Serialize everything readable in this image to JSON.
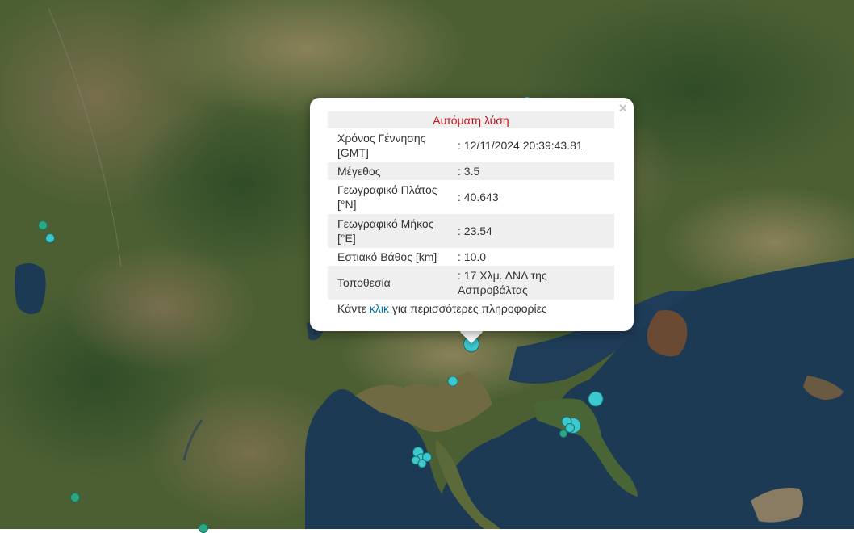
{
  "map": {
    "markers": [
      {
        "label": "earthquake-epicenter",
        "color": "#3cc8cf",
        "size": "medium"
      },
      {
        "label": "earthquake-epicenter",
        "color": "#3cc8cf",
        "size": "small"
      },
      {
        "label": "earthquake-epicenter",
        "color": "#3cc8cf",
        "size": "medium"
      },
      {
        "label": "earthquake-epicenter",
        "color": "#3cc8cf",
        "size": "medium"
      },
      {
        "label": "earthquake-epicenter",
        "color": "#3cc8cf",
        "size": "small"
      },
      {
        "label": "earthquake-epicenter",
        "color": "#3cc8cf",
        "size": "small"
      },
      {
        "label": "earthquake-epicenter",
        "color": "#3cc8cf",
        "size": "small"
      },
      {
        "label": "earthquake-epicenter",
        "color": "#3cc8cf",
        "size": "small"
      },
      {
        "label": "earthquake-epicenter",
        "color": "#3cc8cf",
        "size": "small"
      },
      {
        "label": "earthquake-epicenter",
        "color": "#3cc8cf",
        "size": "small"
      },
      {
        "label": "earthquake-epicenter",
        "color": "#3cc8cf",
        "size": "small"
      },
      {
        "label": "earthquake-epicenter",
        "color": "#3cc8cf",
        "size": "small"
      },
      {
        "label": "earthquake-epicenter",
        "color": "#2aa882",
        "size": "small"
      },
      {
        "label": "earthquake-epicenter",
        "color": "#2aa882",
        "size": "small"
      },
      {
        "label": "earthquake-epicenter",
        "color": "#2aa882",
        "size": "small"
      },
      {
        "label": "earthquake-epicenter",
        "color": "#2aa882",
        "size": "small"
      },
      {
        "label": "earthquake-epicenter",
        "color": "#3cc8cf",
        "size": "small"
      }
    ]
  },
  "popup": {
    "title": "Αυτόματη λύση",
    "close_symbol": "×",
    "rows": [
      {
        "label": "Χρόνος Γέννησης [GMT]",
        "value": ": 12/11/2024 20:39:43.81"
      },
      {
        "label": "Μέγεθος",
        "value": ": 3.5"
      },
      {
        "label": "Γεωγραφικό Πλάτος [°N]",
        "value": ": 40.643"
      },
      {
        "label": "Γεωγραφικό Μήκος [°E]",
        "value": ": 23.54"
      },
      {
        "label": "Εστιακό Βάθος [km]",
        "value": ": 10.0"
      },
      {
        "label": "Τοποθεσία",
        "value": ": 17 Χλμ. ΔΝΔ της Ασπροβάλτας"
      }
    ],
    "more_prefix": "Κάντε ",
    "more_link": "κλικ",
    "more_suffix": " για περισσότερες πληροφορίες"
  }
}
